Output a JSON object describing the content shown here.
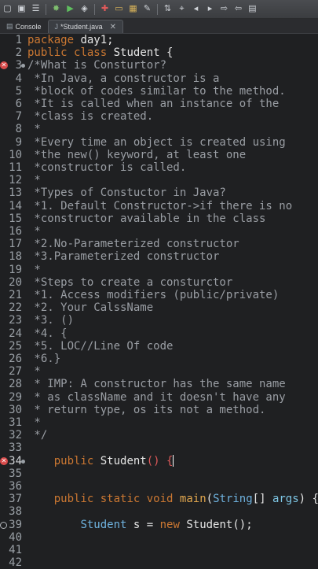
{
  "toolbar": {
    "icons": [
      "new-icon",
      "save-icon",
      "menu-icon",
      "debug-icon",
      "run-icon",
      "external-tools-icon",
      "new-project-icon",
      "open-folder-icon",
      "new-package-icon",
      "brush-icon",
      "toggle-icon",
      "pin-icon",
      "back-icon",
      "forward-icon",
      "next-icon",
      "prev-icon",
      "terminal-icon"
    ]
  },
  "tabs": [
    {
      "label": "Console",
      "active": false
    },
    {
      "label": "*Student.java",
      "active": true,
      "close": "✕"
    }
  ],
  "editor": {
    "lines": [
      {
        "n": "1",
        "code": "package day1;"
      },
      {
        "n": "2",
        "code": "public class Student {"
      },
      {
        "n": "3",
        "code": "/*What is Consturtor?"
      },
      {
        "n": "4",
        "code": " *In Java, a constructor is a"
      },
      {
        "n": "5",
        "code": " *block of codes similar to the method."
      },
      {
        "n": "6",
        "code": " *It is called when an instance of the"
      },
      {
        "n": "7",
        "code": " *class is created."
      },
      {
        "n": "8",
        "code": " *"
      },
      {
        "n": "9",
        "code": " *Every time an object is created using"
      },
      {
        "n": "10",
        "code": " *the new() keyword, at least one"
      },
      {
        "n": "11",
        "code": " *constructor is called."
      },
      {
        "n": "12",
        "code": " *"
      },
      {
        "n": "13",
        "code": " *Types of Constuctor in Java?"
      },
      {
        "n": "14",
        "code": " *1. Default Constructor->if there is no"
      },
      {
        "n": "15",
        "code": " *constructor available in the class"
      },
      {
        "n": "16",
        "code": " *"
      },
      {
        "n": "17",
        "code": " *2.No-Parameterized constructor"
      },
      {
        "n": "18",
        "code": " *3.Parameterized constructor"
      },
      {
        "n": "19",
        "code": " *"
      },
      {
        "n": "20",
        "code": " *Steps to create a consturctor"
      },
      {
        "n": "21",
        "code": " *1. Access modifiers (public/private)"
      },
      {
        "n": "22",
        "code": " *2. Your CalssName"
      },
      {
        "n": "23",
        "code": " *3. ()"
      },
      {
        "n": "24",
        "code": " *4. {"
      },
      {
        "n": "25",
        "code": " *5. LOC//Line Of code"
      },
      {
        "n": "26",
        "code": " *6.}"
      },
      {
        "n": "27",
        "code": " *"
      },
      {
        "n": "28",
        "code": " * IMP: A constructor has the same name"
      },
      {
        "n": "29",
        "code": " * as className and it doesn't have any"
      },
      {
        "n": "30",
        "code": " * return type, os its not a method."
      },
      {
        "n": "31",
        "code": " *"
      },
      {
        "n": "32",
        "code": " */"
      },
      {
        "n": "33",
        "code": ""
      },
      {
        "n": "34",
        "code": "    public Student() {"
      },
      {
        "n": "35",
        "code": ""
      },
      {
        "n": "36",
        "code": ""
      },
      {
        "n": "37",
        "code": "    public static void main(String[] args) {"
      },
      {
        "n": "38",
        "code": ""
      },
      {
        "n": "39",
        "code": "        Student s = new Student();"
      },
      {
        "n": "40",
        "code": ""
      },
      {
        "n": "41",
        "code": ""
      },
      {
        "n": "42",
        "code": ""
      }
    ],
    "error_lines": [
      "3",
      "34"
    ],
    "warning_lines": [
      "39"
    ],
    "fold_lines": [
      "3",
      "34"
    ],
    "cursor_line": "34"
  },
  "colors": {
    "background": "#1f2022",
    "keyword": "#cc7832",
    "comment": "#9a9ea4",
    "type": "#6fb3e0",
    "method": "#e0a64e",
    "error": "#d84b4b"
  }
}
